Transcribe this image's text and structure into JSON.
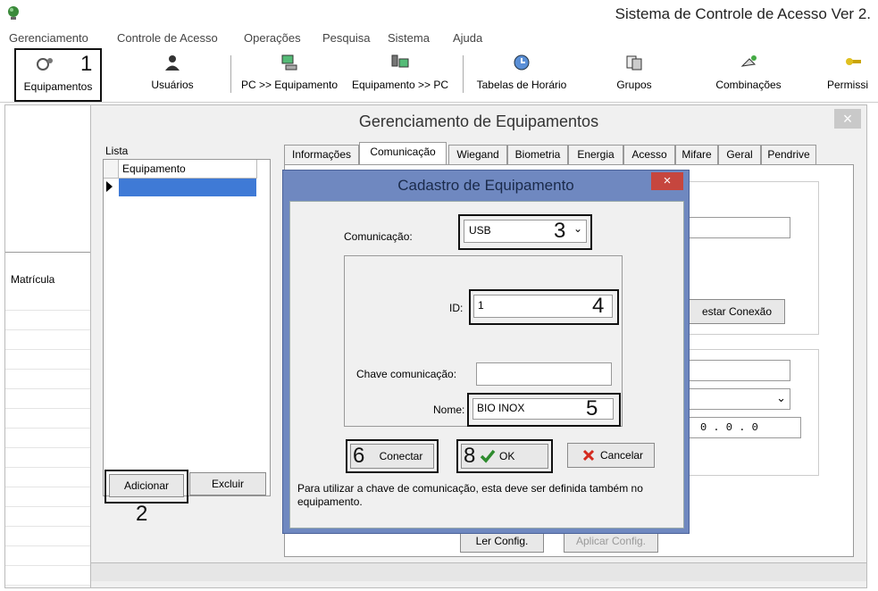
{
  "app": {
    "title": "Sistema de Controle de Acesso Ver 2."
  },
  "menu": [
    "Gerenciamento",
    "Controle de Acesso",
    "Operações",
    "Pesquisa",
    "Sistema",
    "Ajuda"
  ],
  "toolbar": {
    "equipamentos": "Equipamentos",
    "usuarios": "Usuários",
    "pc_equip": "PC >> Equipamento",
    "equip_pc": "Equipamento >> PC",
    "tabelas": "Tabelas de Horário",
    "grupos": "Grupos",
    "combinacoes": "Combinações",
    "permissoes": "Permissi"
  },
  "callouts": {
    "n1": "1",
    "n2": "2",
    "n3": "3",
    "n4": "4",
    "n5": "5",
    "n6": "6",
    "n8": "8"
  },
  "left_pane": {
    "matricula": "Matrícula"
  },
  "window": {
    "title": "Gerenciamento de Equipamentos",
    "close": "×",
    "lista_label": "Lista",
    "list_header": "Equipamento",
    "add_button": "Adicionar",
    "delete_button": "Excluir",
    "tabs": [
      "Informações",
      "Comunicação",
      "Wiegand",
      "Biometria",
      "Energia",
      "Acesso",
      "Mifare",
      "Geral",
      "Pendrive"
    ],
    "test_conn_button": "estar Conexão",
    "ip_value": "0 . 0 . 0",
    "read_config_button": "Ler Config.",
    "apply_config_button": "Aplicar Config."
  },
  "dialog": {
    "title": "Cadastro de Equipamento",
    "close": "×",
    "comunicacao_label": "Comunicação:",
    "comunicacao_value": "USB",
    "id_label": "ID:",
    "id_value": "1",
    "chave_label": "Chave comunicação:",
    "chave_value": "",
    "nome_label": "Nome:",
    "nome_value": "BIO INOX",
    "connect_button": "Conectar",
    "ok_button": "OK",
    "cancel_button": "Cancelar",
    "note": "Para utilizar a chave de comunicação, esta deve ser definida também no equipamento."
  },
  "colors": {
    "dialog_frame": "#6f88c0",
    "close_red": "#c6463e",
    "selection": "#3f7ad6",
    "ok_green": "#2e8b2e",
    "cancel_red": "#d42a1e"
  }
}
